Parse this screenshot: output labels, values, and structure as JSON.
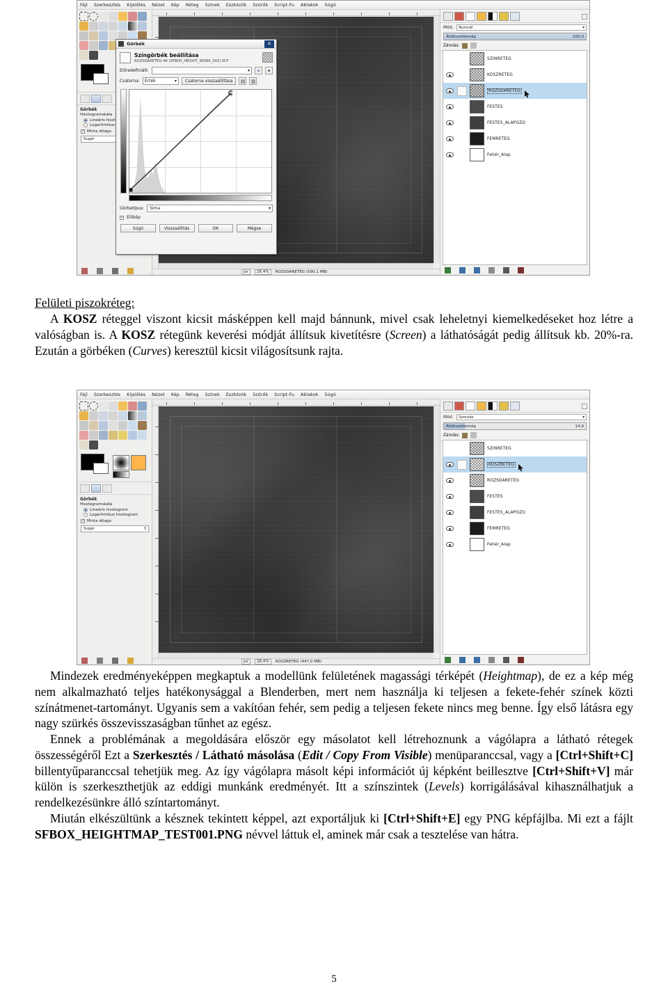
{
  "gimp": {
    "menubar": [
      "Fájl",
      "Szerkesztés",
      "Kijelölés",
      "Nézet",
      "Kép",
      "Réteg",
      "Színek",
      "Eszközök",
      "Szűrők",
      "Script-Fu",
      "Ablakok",
      "Súgó"
    ],
    "tool_options": {
      "title": "Görbék",
      "histogram_label": "Hisztogramskála",
      "radio_linear": "Lineáris hisztogram",
      "radio_log": "Logaritmikus hisztogram",
      "check_sample_average": "Minta átlaga",
      "radius_label": "Sugár",
      "radius_value": "3"
    },
    "dock": {
      "mode_label": "Mód:",
      "lock_label": "Zárolás:",
      "opacity_label": "Átlátszatlanság"
    },
    "screenshot1": {
      "mode_value": "Normál",
      "opacity_value": "100,0",
      "status_unit": "px",
      "status_zoom": "28,4%",
      "status_title": "ROZSDARETEG (590,1 MB)",
      "selected_layer": "ROZSDARETEG",
      "layers": [
        {
          "name": "SZINRETEG",
          "kind": "checker"
        },
        {
          "name": "KOSZRETEG",
          "kind": "checker"
        },
        {
          "name": "ROZSDARETEG",
          "kind": "checker"
        },
        {
          "name": "FESTES",
          "kind": "dark"
        },
        {
          "name": "FESTES_ALAPOZO",
          "kind": "dark"
        },
        {
          "name": "FEMRETEG",
          "kind": "black"
        },
        {
          "name": "Fehér_Alap",
          "kind": "white"
        }
      ]
    },
    "screenshot2": {
      "mode_value": "Szorzás",
      "opacity_value": "14,9",
      "status_unit": "px",
      "status_zoom": "28,4%",
      "status_title": "KOSZRETEG (447,0 MB)",
      "selected_layer": "KOSZRETEG",
      "layers": [
        {
          "name": "SZINRETEG",
          "kind": "checker"
        },
        {
          "name": "KOSZRETEG",
          "kind": "checker"
        },
        {
          "name": "ROZSDARETEG",
          "kind": "checker"
        },
        {
          "name": "FESTES",
          "kind": "dark"
        },
        {
          "name": "FESTES_ALAPOZO",
          "kind": "dark"
        },
        {
          "name": "FEMRETEG",
          "kind": "black"
        },
        {
          "name": "Fehér_Alap",
          "kind": "white"
        }
      ]
    }
  },
  "curves_dialog": {
    "window_title": "Görbék",
    "heading": "Színgörbék beállítása",
    "subheading": "ROZSDARETEG-48 (SFBOX_HEIGHT_WORK_002).XCF",
    "preset_label": "Előredefiniált:",
    "preset_value": "",
    "channel_label": "Csatorna:",
    "channel_value": "Érték",
    "channel_reset_button": "Csatorna visszaállítása",
    "curve_type_label": "Görbetípus:",
    "curve_type_value": "Sima",
    "preview_label": "Előkép",
    "buttons": {
      "help": "Súgó",
      "reset": "Visszaállítás",
      "ok": "OK",
      "cancel": "Mégse"
    }
  },
  "document": {
    "section_heading": "Felületi piszokréteg:",
    "para1": {
      "part1": "A ",
      "b1": "KOSZ",
      "part2": " réteggel viszont kicsit másképpen kell majd bánnunk, mivel csak leheletnyi kiemelkedéseket hoz létre a valóságban is. A ",
      "b2": "KOSZ",
      "part3": " rétegünk keverési módját állítsuk kivetítésre (",
      "i1": "Screen",
      "part4": ") a láthatóságát pedig állítsuk kb. 20%-ra. Ezután a görbéken (",
      "i2": "Curves",
      "part5": ") keresztül kicsit világosítsunk rajta."
    },
    "para2": {
      "part1": "Mindezek eredményeképpen megkaptuk a modellünk felületének magassági térképét (",
      "i1": "Heightmap",
      "part2": "), de ez a kép még nem alkalmazható teljes hatékonysággal a Blenderben, mert nem használja ki teljesen a fekete-fehér színek közti színátmenet-tartományt. Ugyanis sem a vakítóan fehér, sem pedig a teljesen fekete nincs meg benne. Így első látásra egy nagy szürkés összevisszaságban tűnhet az egész."
    },
    "para3": {
      "part1": "Ennek a problémának a megoldására először egy másolatot kell létrehoznunk a vágólapra a látható rétegek összességéről Ezt a ",
      "b1": "Szerkesztés / Látható másolása",
      "part2": " (",
      "bi1": "Edit / Copy From Visible",
      "part3": ") menüparanccsal, vagy a ",
      "b2": "[Ctrl+Shift+C]",
      "part4": " billentyűparanccsal tehetjük meg. Az így vágólapra másolt képi információt új képként beillesztve ",
      "b3": "[Ctrl+Shift+V]",
      "part5": " már külön is szerkeszthetjük az eddigi munkánk eredményét. Itt a színszintek (",
      "i1": "Levels",
      "part6": ") korrigálásával kihasználhatjuk a rendelkezésünkre álló színtartományt."
    },
    "para4": {
      "part1": "Miután elkészültünk a késznek tekintett képpel, azt exportáljuk ki ",
      "b1": "[Ctrl+Shift+E]",
      "part2": " egy PNG képfájlba. Mi ezt a fájlt ",
      "b2": "SFBOX_HEIGHTMAP_TEST001.PNG",
      "part3": " névvel láttuk el, aminek már csak a tesztelése van hátra."
    },
    "page_number": "5"
  },
  "colors": {
    "selection_blue": "#bcd9f0",
    "title_blue": "#1b3f77",
    "canvas_gray": "#3c3c3c"
  }
}
